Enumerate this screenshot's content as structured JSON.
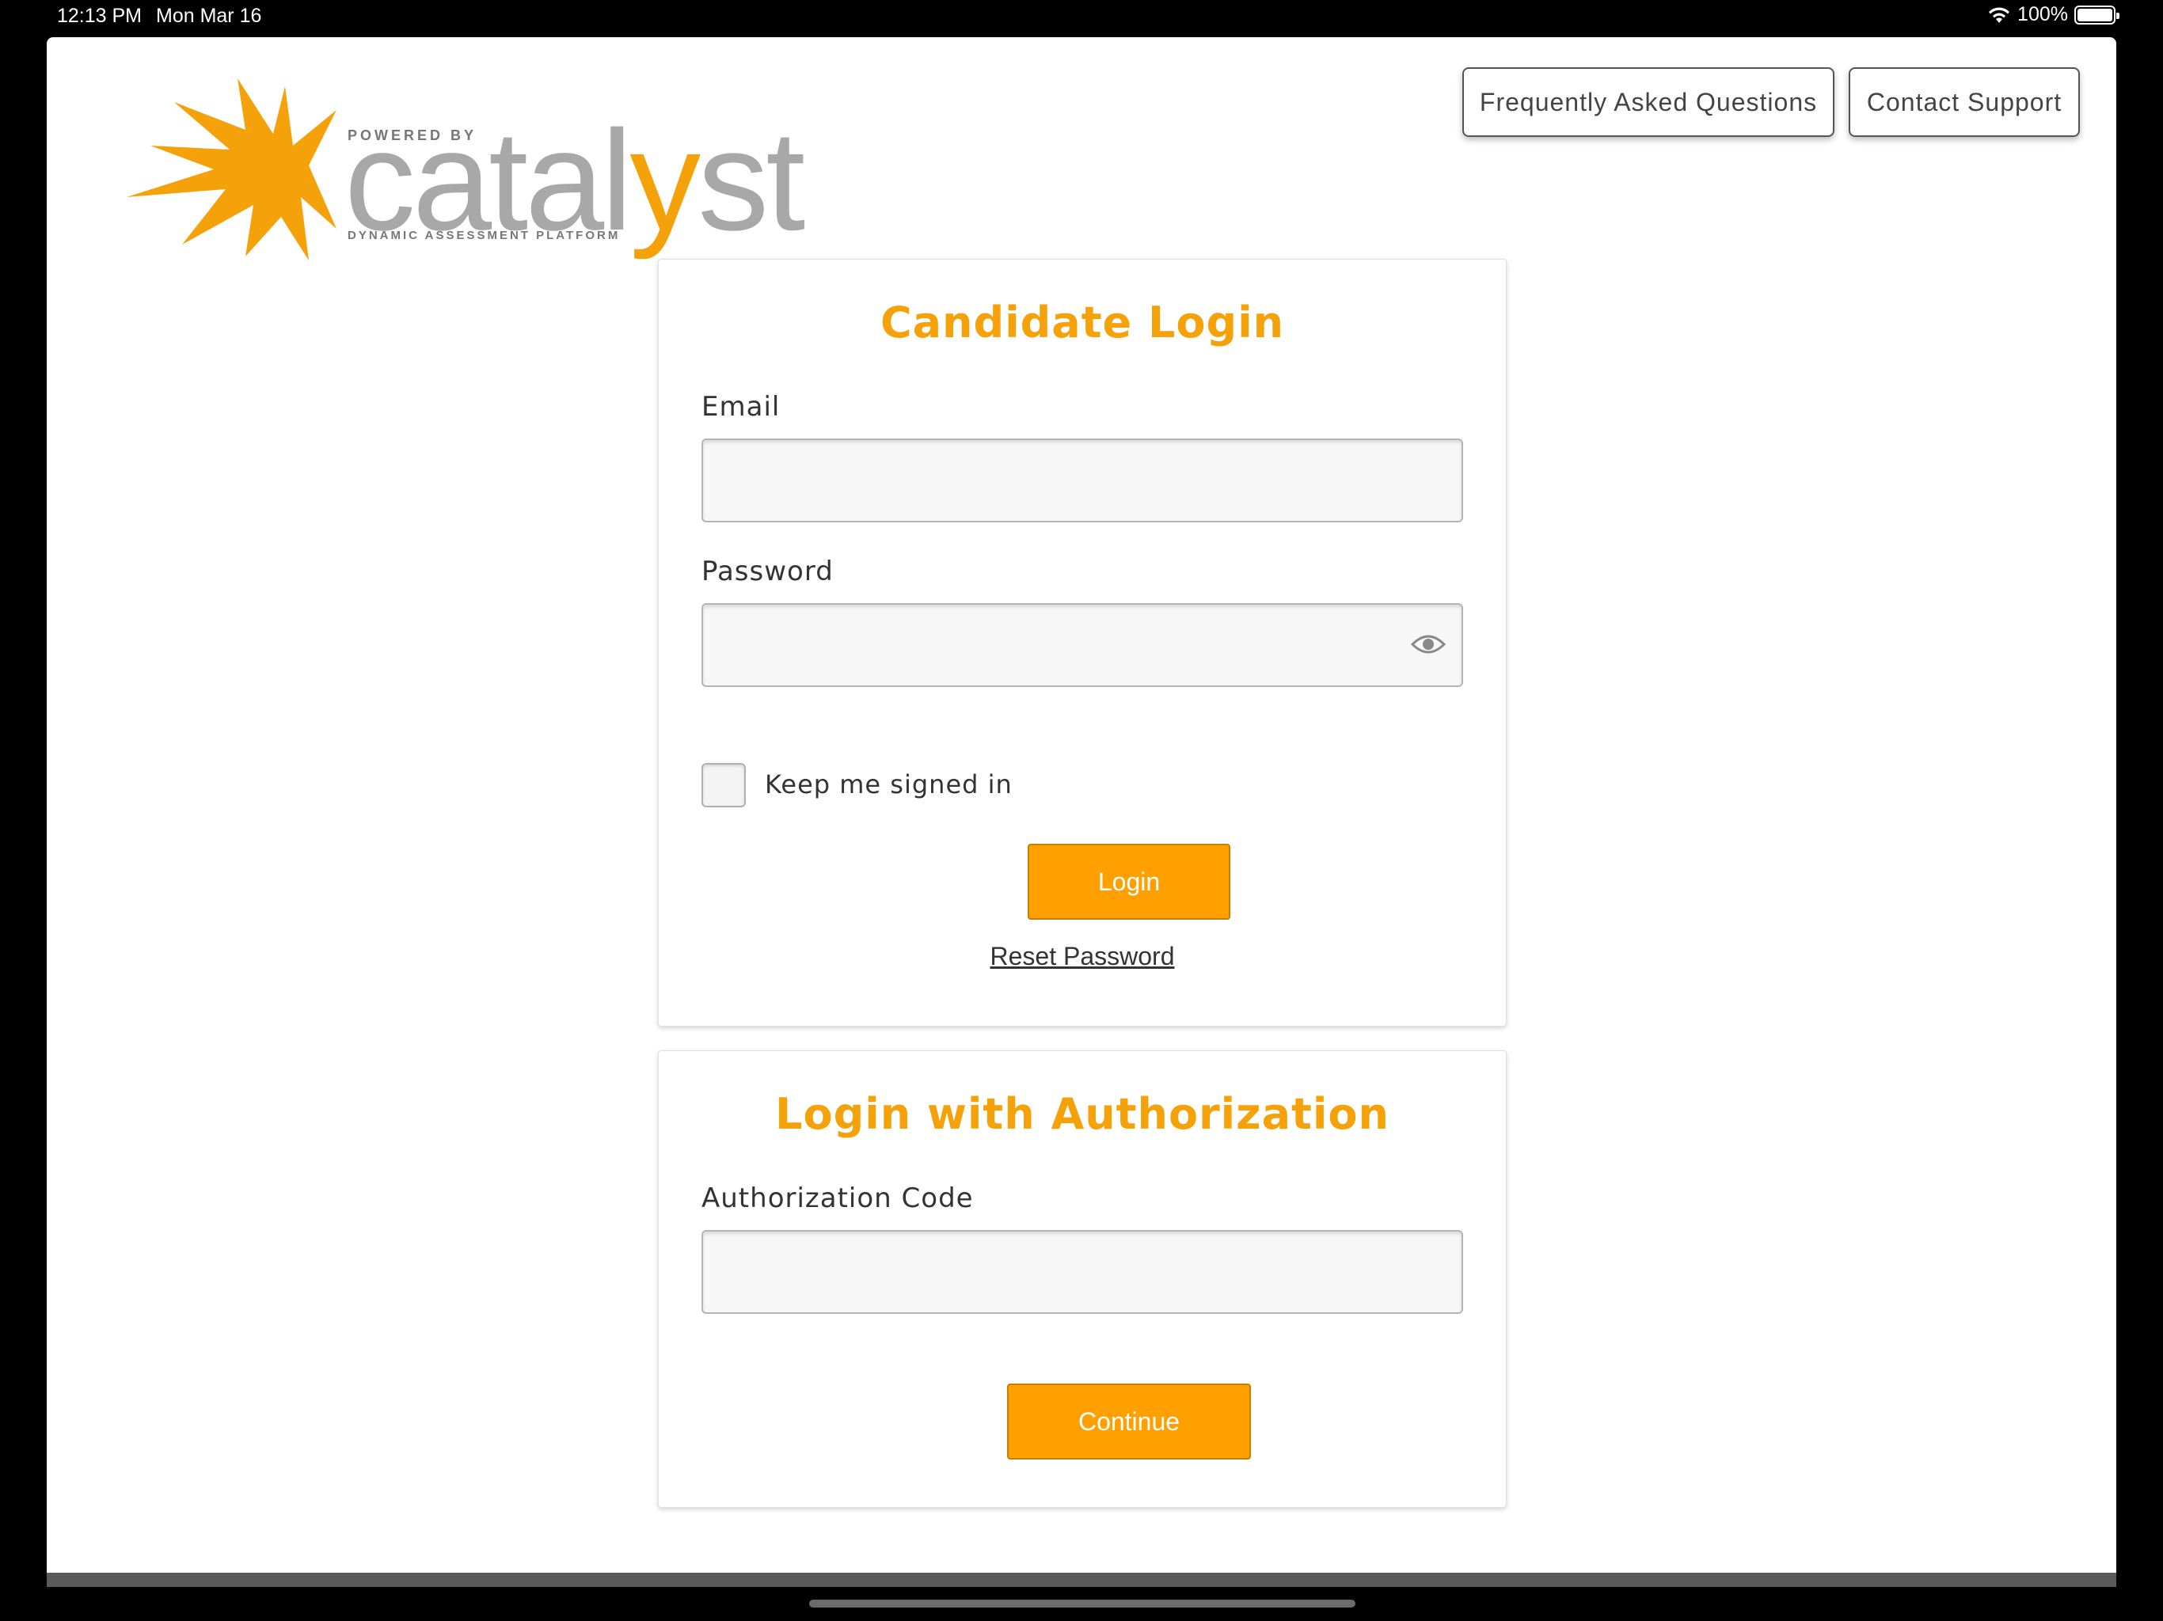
{
  "status_bar": {
    "time": "12:13 PM",
    "date": "Mon Mar 16",
    "battery": "100%"
  },
  "logo": {
    "powered_by": "POWERED BY",
    "word_prefix": "catal",
    "word_y": "y",
    "word_suffix": "st",
    "tagline": "DYNAMIC ASSESSMENT PLATFORM"
  },
  "header": {
    "faq_label": "Frequently Asked Questions",
    "support_label": "Contact Support"
  },
  "candidate_login": {
    "title": "Candidate Login",
    "email_label": "Email",
    "email_value": "",
    "password_label": "Password",
    "password_value": "",
    "keep_signed_in_label": "Keep me signed in",
    "login_button": "Login",
    "reset_link": "Reset Password"
  },
  "auth_login": {
    "title": "Login with Authorization",
    "code_label": "Authorization Code",
    "code_value": "",
    "continue_button": "Continue"
  },
  "colors": {
    "accent": "#ffa000",
    "title": "#f5a20a",
    "logo_gray": "#a8a8a8"
  }
}
